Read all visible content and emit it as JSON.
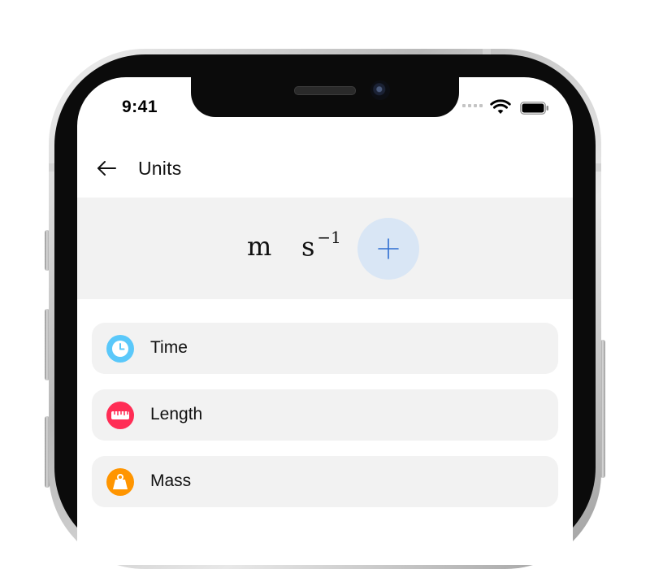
{
  "status_bar": {
    "time": "9:41"
  },
  "app_bar": {
    "back_icon": "arrow-left-icon",
    "title": "Units"
  },
  "formula": {
    "tokens": [
      {
        "base": "m",
        "exponent": ""
      },
      {
        "base": "s",
        "exponent": "−1"
      }
    ],
    "add_icon": "plus-icon",
    "add_button_color": "#d9e6f5",
    "accent": "#2f6fd1"
  },
  "categories": [
    {
      "label": "Time",
      "icon": "clock-icon",
      "color": "#5ac8fa"
    },
    {
      "label": "Length",
      "icon": "ruler-icon",
      "color": "#ff2d55"
    },
    {
      "label": "Mass",
      "icon": "weight-icon",
      "color": "#ff9500"
    }
  ]
}
